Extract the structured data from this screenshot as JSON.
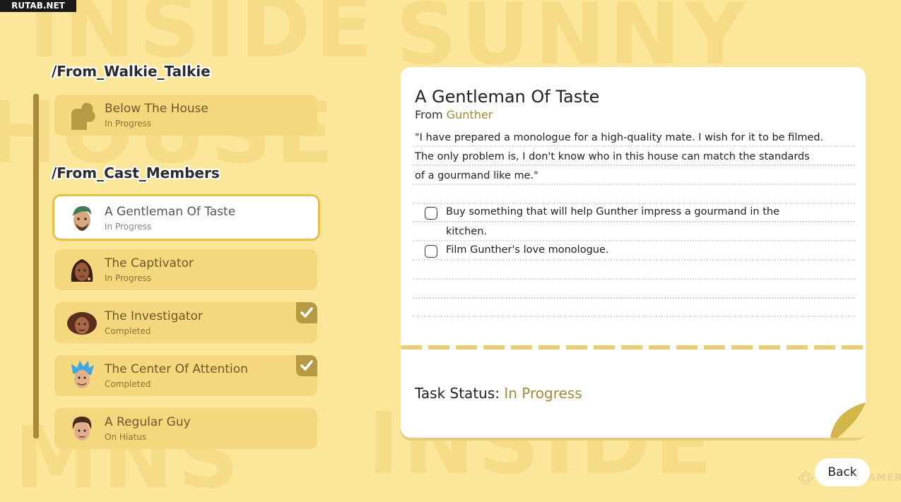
{
  "site_tag": "RUTAB.NET",
  "sections": [
    {
      "title": "/From_Walkie_Talkie",
      "quests": [
        {
          "name": "Below The House",
          "status": "In Progress",
          "avatar": "walkie-talkie-silhouette",
          "completed": false
        }
      ]
    },
    {
      "title": "/From_Cast_Members",
      "quests": [
        {
          "name": "A Gentleman Of Taste",
          "status": "In Progress",
          "avatar": "gunther-portrait",
          "completed": false,
          "selected": true
        },
        {
          "name": "The Captivator",
          "status": "In Progress",
          "avatar": "captivator-portrait",
          "completed": false
        },
        {
          "name": "The Investigator",
          "status": "Completed",
          "avatar": "investigator-portrait",
          "completed": true
        },
        {
          "name": "The Center Of Attention",
          "status": "Completed",
          "avatar": "blue-hair-portrait",
          "completed": true
        },
        {
          "name": "A Regular Guy",
          "status": "On Hiatus",
          "avatar": "regular-guy-portrait",
          "completed": false
        }
      ]
    }
  ],
  "detail": {
    "title": "A Gentleman Of Taste",
    "from_label": "From",
    "from_name": "Gunther",
    "description_lines": [
      "\"I have prepared a monologue for a high-quality mate. I wish for it to be filmed.",
      "The only problem is, I don't know who in this house can match the standards",
      "of a gourmand like me.\""
    ],
    "tasks": [
      {
        "lines": [
          "Buy something that will help Gunther impress a gourmand in the",
          "kitchen."
        ],
        "done": false
      },
      {
        "lines": [
          "Film Gunther's love monologue."
        ],
        "done": false
      }
    ],
    "status_label": "Task Status:",
    "status_value": "In Progress"
  },
  "back_button": "Back",
  "watermark": "THEGAMER",
  "colors": {
    "background": "#fbe69a",
    "card_item": "#f5d77e",
    "accent_gold": "#a08a3c",
    "selected_border": "#e8c048"
  }
}
